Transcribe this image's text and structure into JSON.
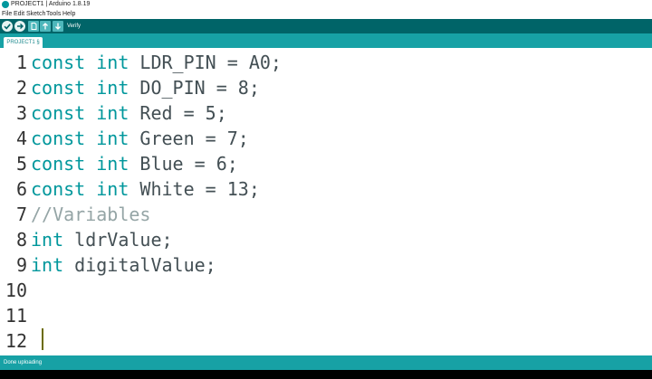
{
  "window": {
    "title": "PROJECT1 | Arduino 1.8.19"
  },
  "menu": [
    "File",
    "Edit",
    "Sketch",
    "Tools",
    "Help"
  ],
  "toolbar": {
    "buttons": [
      {
        "name": "verify-button",
        "icon": "check-icon"
      },
      {
        "name": "upload-button",
        "icon": "arrow-right-icon"
      },
      {
        "name": "new-button",
        "icon": "new-file-icon"
      },
      {
        "name": "open-button",
        "icon": "arrow-up-icon"
      },
      {
        "name": "save-button",
        "icon": "arrow-down-icon"
      }
    ],
    "hint": "Verify"
  },
  "tab": {
    "label": "PROJECT1 §"
  },
  "editor": {
    "lines": [
      {
        "number": "1",
        "tokens": [
          {
            "t": "const",
            "c": "kw"
          },
          {
            "t": " "
          },
          {
            "t": "int",
            "c": "kw"
          },
          {
            "t": " LDR_PIN = A0;"
          }
        ]
      },
      {
        "number": "2",
        "tokens": [
          {
            "t": "const",
            "c": "kw"
          },
          {
            "t": " "
          },
          {
            "t": "int",
            "c": "kw"
          },
          {
            "t": " DO_PIN = 8;"
          }
        ]
      },
      {
        "number": "3",
        "tokens": [
          {
            "t": "const",
            "c": "kw"
          },
          {
            "t": " "
          },
          {
            "t": "int",
            "c": "kw"
          },
          {
            "t": " Red = 5;"
          }
        ]
      },
      {
        "number": "4",
        "tokens": [
          {
            "t": "const",
            "c": "kw"
          },
          {
            "t": " "
          },
          {
            "t": "int",
            "c": "kw"
          },
          {
            "t": " Green = 7;"
          }
        ]
      },
      {
        "number": "5",
        "tokens": [
          {
            "t": "const",
            "c": "kw"
          },
          {
            "t": " "
          },
          {
            "t": "int",
            "c": "kw"
          },
          {
            "t": " Blue = 6;"
          }
        ]
      },
      {
        "number": "6",
        "tokens": [
          {
            "t": "const",
            "c": "kw"
          },
          {
            "t": " "
          },
          {
            "t": "int",
            "c": "kw"
          },
          {
            "t": " White = 13;"
          }
        ]
      },
      {
        "number": "7",
        "tokens": [
          {
            "t": "//Variables",
            "c": "cm"
          }
        ]
      },
      {
        "number": "8",
        "tokens": [
          {
            "t": "int",
            "c": "kw"
          },
          {
            "t": " ldrValue;"
          }
        ]
      },
      {
        "number": "9",
        "tokens": [
          {
            "t": "int",
            "c": "kw"
          },
          {
            "t": " digitalValue;"
          }
        ]
      },
      {
        "number": "10",
        "tokens": []
      },
      {
        "number": "11",
        "tokens": []
      },
      {
        "number": "12",
        "tokens": []
      }
    ]
  },
  "status": {
    "text": "Done uploading"
  },
  "colors": {
    "toolbar": "#006468",
    "tabbar": "#17a1a5",
    "keyword": "#00979c",
    "comment": "#95a5a6"
  }
}
